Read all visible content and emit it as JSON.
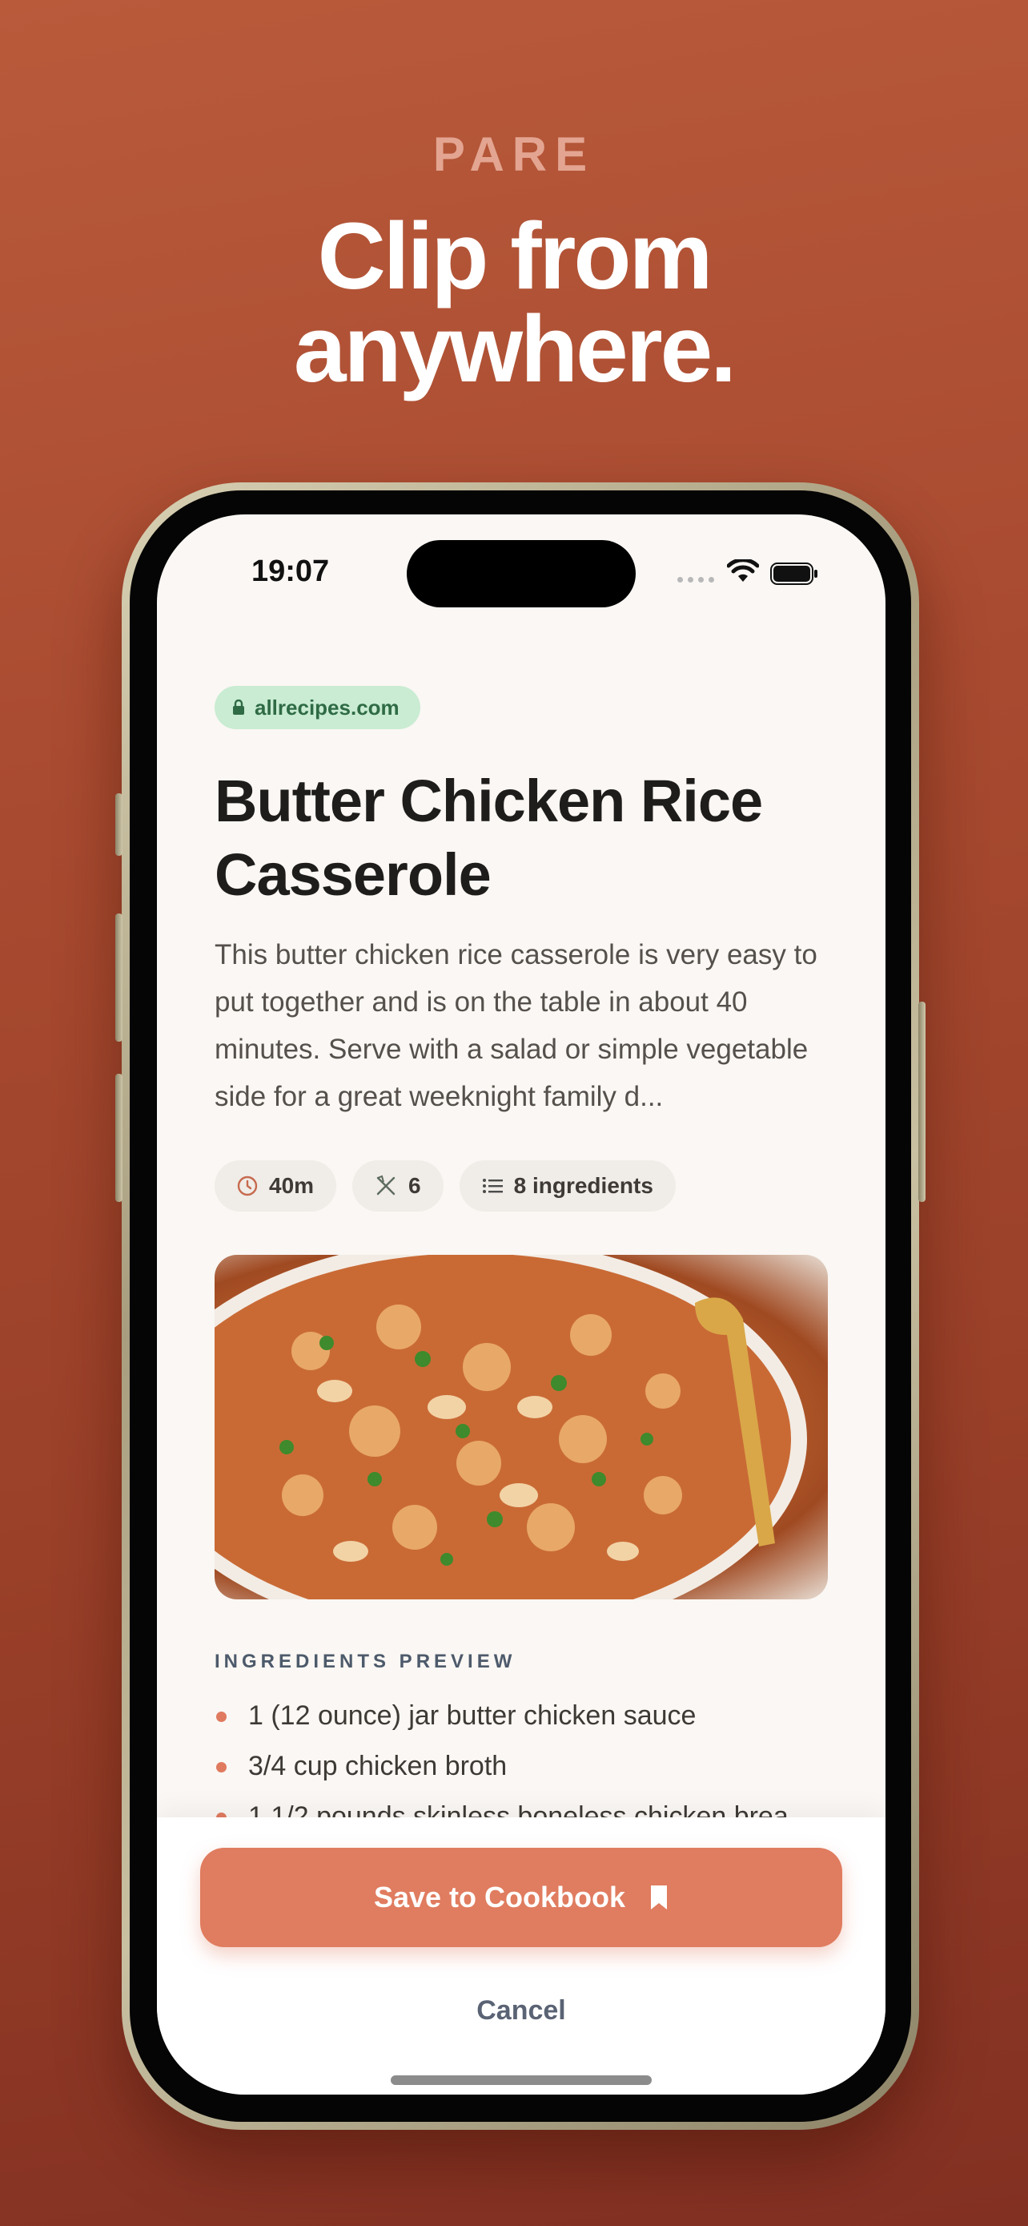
{
  "brand": "PARE",
  "headline_line1": "Clip from",
  "headline_line2": "anywhere.",
  "status_bar": {
    "time": "19:07"
  },
  "recipe": {
    "domain": "allrecipes.com",
    "title": "Butter Chicken Rice Casserole",
    "description": "This butter chicken rice casserole is very easy to put together and is on the table in about 40 minutes. Serve with a salad or simple vegetable side for a great weeknight family d...",
    "meta": {
      "time": "40m",
      "servings": "6",
      "ingredients": "8 ingredients"
    },
    "image_alt": "Butter chicken rice casserole in a pan"
  },
  "ingredients_preview": {
    "label": "INGREDIENTS PREVIEW",
    "items": [
      "1 (12 ounce) jar butter chicken sauce",
      "3/4 cup chicken broth",
      "1 1/2 pounds skinless boneless chicken brea..."
    ]
  },
  "actions": {
    "save_label": "Save to Cookbook",
    "cancel_label": "Cancel"
  },
  "colors": {
    "accent": "#e07c5f",
    "background": "#a84a30",
    "domain_pill": "#c9ecd2",
    "screen": "#faf7f4"
  },
  "icons": [
    "lock-icon",
    "clock-icon",
    "utensils-icon",
    "list-icon",
    "bookmark-icon",
    "wifi-icon",
    "battery-icon"
  ]
}
